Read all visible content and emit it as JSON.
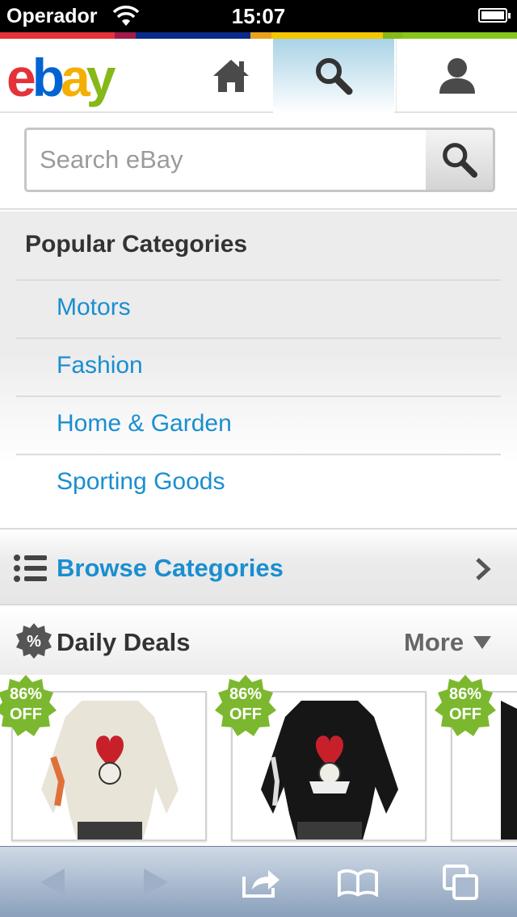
{
  "status_bar": {
    "carrier": "Operador",
    "time": "15:07"
  },
  "header": {
    "logo": "ebay",
    "tabs": [
      {
        "name": "home",
        "icon": "home-icon"
      },
      {
        "name": "search",
        "icon": "search-icon",
        "active": true
      },
      {
        "name": "account",
        "icon": "user-icon"
      }
    ]
  },
  "search": {
    "placeholder": "Search eBay"
  },
  "popular": {
    "title": "Popular Categories",
    "items": [
      {
        "label": "Motors"
      },
      {
        "label": "Fashion"
      },
      {
        "label": "Home & Garden"
      },
      {
        "label": "Sporting Goods"
      }
    ]
  },
  "browse": {
    "label": "Browse Categories"
  },
  "deals": {
    "title": "Daily Deals",
    "more_label": "More",
    "items": [
      {
        "badge_pct": "86%",
        "badge_off": "OFF",
        "shirt_color": "#e9e4d8"
      },
      {
        "badge_pct": "86%",
        "badge_off": "OFF",
        "shirt_color": "#161616"
      },
      {
        "badge_pct": "86%",
        "badge_off": "OFF",
        "shirt_color": "#161616"
      }
    ]
  },
  "colors": {
    "link": "#1a8ed0",
    "badge_green": "#7cb82f",
    "ebay_e": "#e53238",
    "ebay_b": "#0064d2",
    "ebay_a": "#f5af02",
    "ebay_y": "#86b817"
  }
}
